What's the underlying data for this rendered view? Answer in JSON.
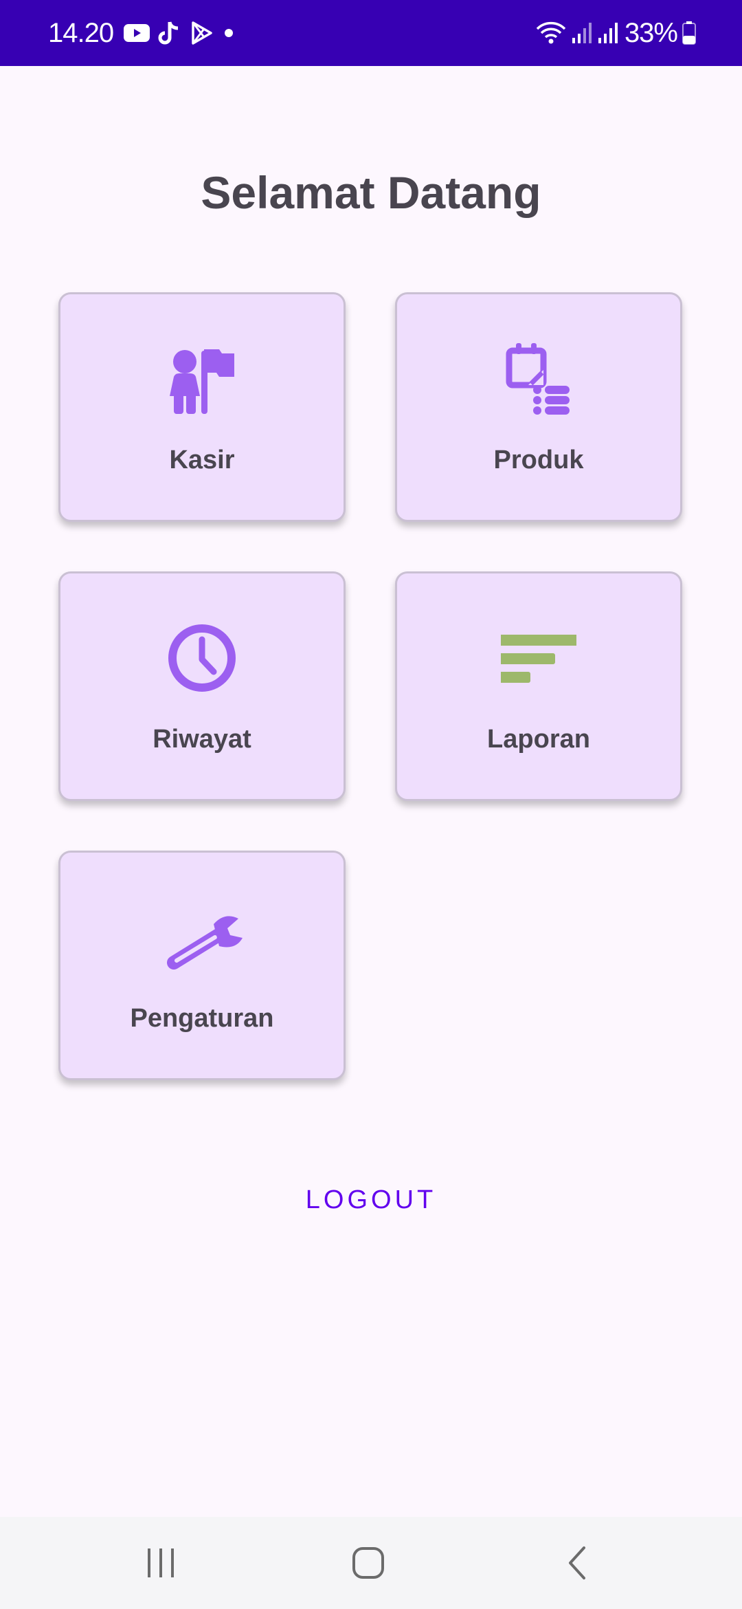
{
  "status_bar": {
    "time": "14.20",
    "battery": "33%",
    "left_icons": [
      "youtube-icon",
      "tiktok-icon",
      "play-store-icon",
      "notification-dot-icon"
    ],
    "right_icons": [
      "wifi-icon",
      "signal-icon",
      "signal-icon",
      "battery-icon"
    ]
  },
  "title": "Selamat Datang",
  "menu": [
    {
      "label": "Kasir",
      "icon": "cashier-person-flag-icon"
    },
    {
      "label": "Produk",
      "icon": "product-list-icon"
    },
    {
      "label": "Riwayat",
      "icon": "clock-icon"
    },
    {
      "label": "Laporan",
      "icon": "sort-lines-icon"
    },
    {
      "label": "Pengaturan",
      "icon": "wrench-icon"
    }
  ],
  "logout_label": "LOGOUT",
  "nav_bar": {
    "buttons": [
      "recent-apps-icon",
      "home-icon",
      "back-icon"
    ]
  },
  "colors": {
    "status_bar": "#3700B3",
    "background": "#FDF7FE",
    "card": "#EFDEFD",
    "icon_purple": "#9C5FF0",
    "icon_green": "#9DB86B",
    "text": "#49454F",
    "accent": "#6200EE"
  }
}
